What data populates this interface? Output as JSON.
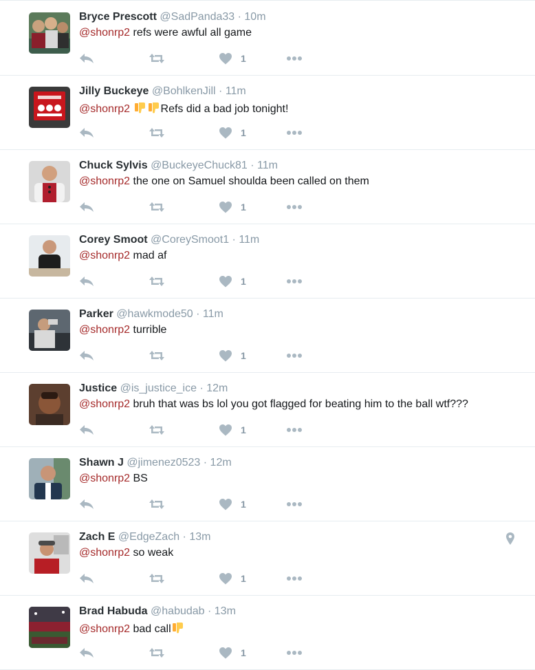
{
  "colors": {
    "mention": "#a52a2a",
    "muted": "#8899a6",
    "action_icon": "#aab8c2",
    "divider": "#e6ecf0"
  },
  "tweets": [
    {
      "name": "Bryce Prescott",
      "handle": "@SadPanda33",
      "time": "10m",
      "mention": "@shonrp2",
      "pre_emoji": [],
      "text": " refs were awful all game",
      "post_emoji": [],
      "likes": "1",
      "geo": false,
      "avatar_icon": "photo-avatar-group"
    },
    {
      "name": "Jilly Buckeye",
      "handle": "@BohlkenJill",
      "time": "11m",
      "mention": "@shonrp2",
      "pre_emoji": [
        "thumbs-down-emoji",
        "thumbs-down-emoji"
      ],
      "text": "Refs did a bad job tonight!",
      "post_emoji": [],
      "likes": "1",
      "geo": false,
      "avatar_icon": "photo-avatar-sign"
    },
    {
      "name": "Chuck Sylvis",
      "handle": "@BuckeyeChuck81",
      "time": "11m",
      "mention": "@shonrp2",
      "pre_emoji": [],
      "text": " the one on Samuel shoulda been called on them",
      "post_emoji": [],
      "likes": "1",
      "geo": false,
      "avatar_icon": "photo-avatar-person"
    },
    {
      "name": "Corey Smoot",
      "handle": "@CoreySmoot1",
      "time": "11m",
      "mention": "@shonrp2",
      "pre_emoji": [],
      "text": " mad af",
      "post_emoji": [],
      "likes": "1",
      "geo": false,
      "avatar_icon": "photo-avatar-person"
    },
    {
      "name": "Parker",
      "handle": "@hawkmode50",
      "time": "11m",
      "mention": "@shonrp2",
      "pre_emoji": [],
      "text": " turrible",
      "post_emoji": [],
      "likes": "1",
      "geo": false,
      "avatar_icon": "photo-avatar-person"
    },
    {
      "name": "Justice",
      "handle": "@is_justice_ice",
      "time": "12m",
      "mention": "@shonrp2",
      "pre_emoji": [],
      "text": " bruh that was bs lol you got flagged for beating him to the ball wtf???",
      "post_emoji": [],
      "likes": "1",
      "geo": false,
      "avatar_icon": "photo-avatar-person"
    },
    {
      "name": "Shawn J",
      "handle": "@jimenez0523",
      "time": "12m",
      "mention": "@shonrp2",
      "pre_emoji": [],
      "text": " BS",
      "post_emoji": [],
      "likes": "1",
      "geo": false,
      "avatar_icon": "photo-avatar-person"
    },
    {
      "name": "Zach E",
      "handle": "@EdgeZach",
      "time": "13m",
      "mention": "@shonrp2",
      "pre_emoji": [],
      "text": " so weak",
      "post_emoji": [],
      "likes": "1",
      "geo": true,
      "avatar_icon": "photo-avatar-person"
    },
    {
      "name": "Brad Habuda",
      "handle": "@habudab",
      "time": "13m",
      "mention": "@shonrp2",
      "pre_emoji": [],
      "text": "  bad call",
      "post_emoji": [
        "thumbs-down-emoji"
      ],
      "likes": "1",
      "geo": false,
      "avatar_icon": "photo-avatar-stadium"
    }
  ]
}
